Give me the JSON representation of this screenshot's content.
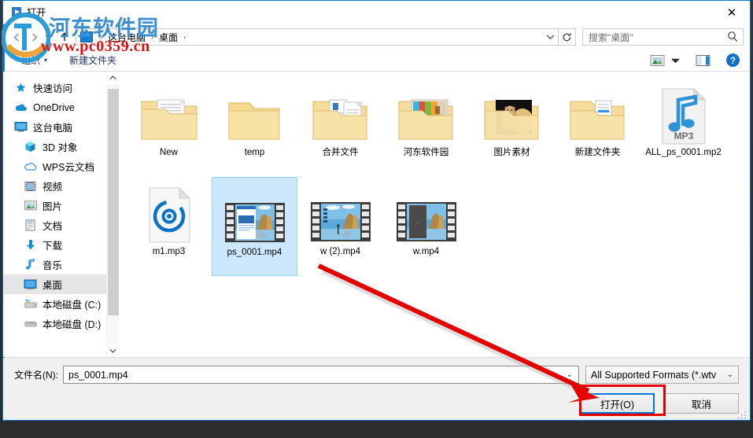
{
  "window": {
    "title": "打开",
    "app_icon": "media-play-icon",
    "close_label": "✕"
  },
  "addressbar": {
    "back_icon": "back-arrow-icon",
    "forward_icon": "forward-arrow-icon",
    "recent_icon": "chevron-down-icon",
    "up_icon": "up-arrow-icon",
    "location_icon": "desktop-icon",
    "crumbs": [
      "这台电脑",
      "桌面"
    ],
    "separator": "›",
    "dropdown_icon": "chevron-down-icon",
    "refresh_icon": "refresh-icon"
  },
  "search": {
    "placeholder": "搜索\"桌面\"",
    "icon": "search-icon"
  },
  "toolbar": {
    "organize_label": "组织",
    "organize_caret": "▾",
    "new_folder_label": "新建文件夹",
    "view_icon": "view-thumbnails-icon",
    "view_caret": "▾",
    "preview_pane_icon": "preview-pane-icon",
    "help_icon": "help-icon",
    "help_glyph": "?"
  },
  "sidebar": {
    "items": [
      {
        "label": "快速访问",
        "icon": "pin-star-icon",
        "indent": false,
        "selected": false
      },
      {
        "label": "OneDrive",
        "icon": "onedrive-cloud-icon",
        "indent": false,
        "selected": false
      },
      {
        "label": "这台电脑",
        "icon": "this-pc-icon",
        "indent": false,
        "selected": false
      },
      {
        "label": "3D 对象",
        "icon": "3d-objects-icon",
        "indent": true,
        "selected": false
      },
      {
        "label": "WPS云文档",
        "icon": "wps-cloud-icon",
        "indent": true,
        "selected": false
      },
      {
        "label": "视频",
        "icon": "videos-icon",
        "indent": true,
        "selected": false
      },
      {
        "label": "图片",
        "icon": "pictures-icon",
        "indent": true,
        "selected": false
      },
      {
        "label": "文档",
        "icon": "documents-icon",
        "indent": true,
        "selected": false
      },
      {
        "label": "下载",
        "icon": "downloads-icon",
        "indent": true,
        "selected": false
      },
      {
        "label": "音乐",
        "icon": "music-icon",
        "indent": true,
        "selected": false
      },
      {
        "label": "桌面",
        "icon": "desktop-icon",
        "indent": true,
        "selected": true
      },
      {
        "label": "本地磁盘 (C:)",
        "icon": "system-drive-icon",
        "indent": true,
        "selected": false
      },
      {
        "label": "本地磁盘 (D:)",
        "icon": "drive-icon",
        "indent": true,
        "selected": false
      }
    ],
    "scroll_up_icon": "chevron-up-icon",
    "scroll_down_icon": "chevron-down-icon"
  },
  "files": [
    {
      "name": "New",
      "kind": "folder-doc",
      "selected": false
    },
    {
      "name": "temp",
      "kind": "folder-empty",
      "selected": false
    },
    {
      "name": "合并文件",
      "kind": "folder-docs",
      "selected": false
    },
    {
      "name": "河东软件园",
      "kind": "folder-colors",
      "selected": false
    },
    {
      "name": "图片素材",
      "kind": "folder-photo",
      "selected": false
    },
    {
      "name": "新建文件夹",
      "kind": "folder-lines",
      "selected": false
    },
    {
      "name": "ALL_ps_0001.mp2",
      "kind": "mp3-file",
      "selected": false
    },
    {
      "name": "m1.mp3",
      "kind": "media-file",
      "selected": false
    },
    {
      "name": "ps_0001.mp4",
      "kind": "video-doc",
      "selected": true
    },
    {
      "name": "w (2).mp4",
      "kind": "video-person",
      "selected": false
    },
    {
      "name": "w.mp4",
      "kind": "video-dark",
      "selected": false
    }
  ],
  "bottom": {
    "filename_label": "文件名(N):",
    "filename_value": "ps_0001.mp4",
    "filename_caret": "⌄",
    "filetype_value": "All Supported Formats (*.wtv",
    "filetype_caret": "⌄",
    "open_button": "打开(O)",
    "cancel_button": "取消"
  },
  "annotations": {
    "arrow_color": "#e50000",
    "highlight_box_color": "#e50000"
  },
  "watermark": {
    "brand": "河东软件园",
    "url": "www.pc0359.cn"
  },
  "colors": {
    "accent": "#0078d7",
    "selection": "#cce8ff",
    "toolbar_text": "#1f3864",
    "red": "#e50000"
  }
}
